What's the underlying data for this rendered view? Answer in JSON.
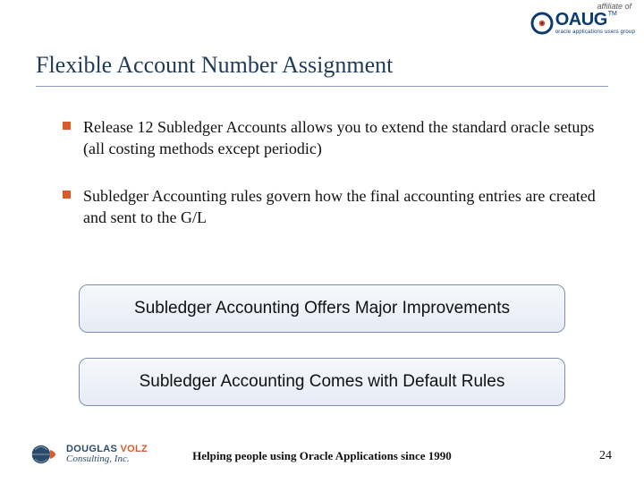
{
  "header": {
    "affiliate_label": "affiliate of",
    "org_name": "OAUG",
    "org_tagline": "oracle applications users group",
    "tm": "TM"
  },
  "title": "Flexible Account Number Assignment",
  "bullets": [
    "Release 12 Subledger Accounts allows you to extend the standard oracle setups (all costing methods except periodic)",
    "Subledger Accounting rules govern how the final accounting entries are created and sent to the G/L"
  ],
  "boxes": [
    "Subledger Accounting Offers Major Improvements",
    "Subledger Accounting Comes with Default Rules"
  ],
  "footer": {
    "company_line1_a": "DOUGLAS ",
    "company_line1_b": "VOLZ",
    "company_line2": "Consulting, Inc.",
    "tagline": "Helping people using Oracle Applications since 1990",
    "page": "24"
  }
}
